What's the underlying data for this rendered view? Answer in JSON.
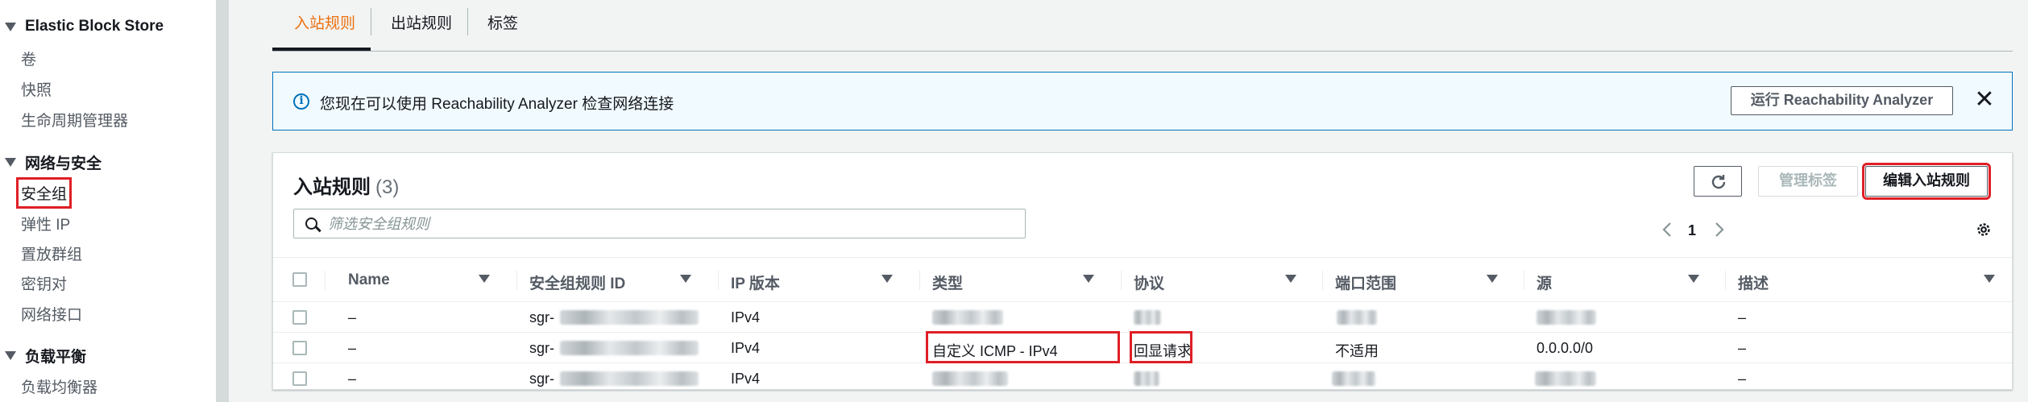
{
  "sidebar": {
    "sections": [
      {
        "title": "Elastic Block Store",
        "items": [
          "卷",
          "快照",
          "生命周期管理器"
        ]
      },
      {
        "title": "网络与安全",
        "items": [
          "安全组",
          "弹性 IP",
          "置放群组",
          "密钥对",
          "网络接口"
        ]
      },
      {
        "title": "负载平衡",
        "items": [
          "负载均衡器"
        ]
      }
    ]
  },
  "tabs": [
    "入站规则",
    "出站规则",
    "标签"
  ],
  "banner": {
    "message": "您现在可以使用 Reachability Analyzer 检查网络连接",
    "button": "运行 Reachability Analyzer"
  },
  "panel": {
    "title": "入站规则",
    "count": "(3)",
    "manage_tags": "管理标签",
    "edit_rules": "编辑入站规则",
    "search_placeholder": "筛选安全组规则",
    "page": "1"
  },
  "table": {
    "columns": [
      "Name",
      "安全组规则 ID",
      "IP 版本",
      "类型",
      "协议",
      "端口范围",
      "源",
      "描述"
    ],
    "rows": [
      {
        "name": "–",
        "rule_id": "sgr-",
        "ip_version": "IPv4",
        "type": "",
        "protocol": "",
        "port_range": "",
        "source": "",
        "description": "–"
      },
      {
        "name": "–",
        "rule_id": "sgr-",
        "ip_version": "IPv4",
        "type": "自定义 ICMP - IPv4",
        "protocol": "回显请求",
        "port_range": "不适用",
        "source": "0.0.0.0/0",
        "description": "–"
      },
      {
        "name": "–",
        "rule_id": "sgr-",
        "ip_version": "IPv4",
        "type": "",
        "protocol": "",
        "port_range": "",
        "source": "",
        "description": "–"
      }
    ]
  },
  "colors": {
    "accent": "#ec7211",
    "highlight": "#df1f26",
    "info": "#0073bb"
  }
}
